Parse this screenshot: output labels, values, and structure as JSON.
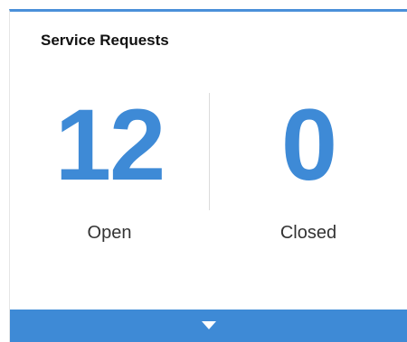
{
  "widget": {
    "title": "Service Requests",
    "accent_color": "#3e8ad6",
    "stats": [
      {
        "value": "12",
        "label": "Open"
      },
      {
        "value": "0",
        "label": "Closed"
      }
    ],
    "footer": {
      "icon": "chevron-down-icon"
    }
  }
}
